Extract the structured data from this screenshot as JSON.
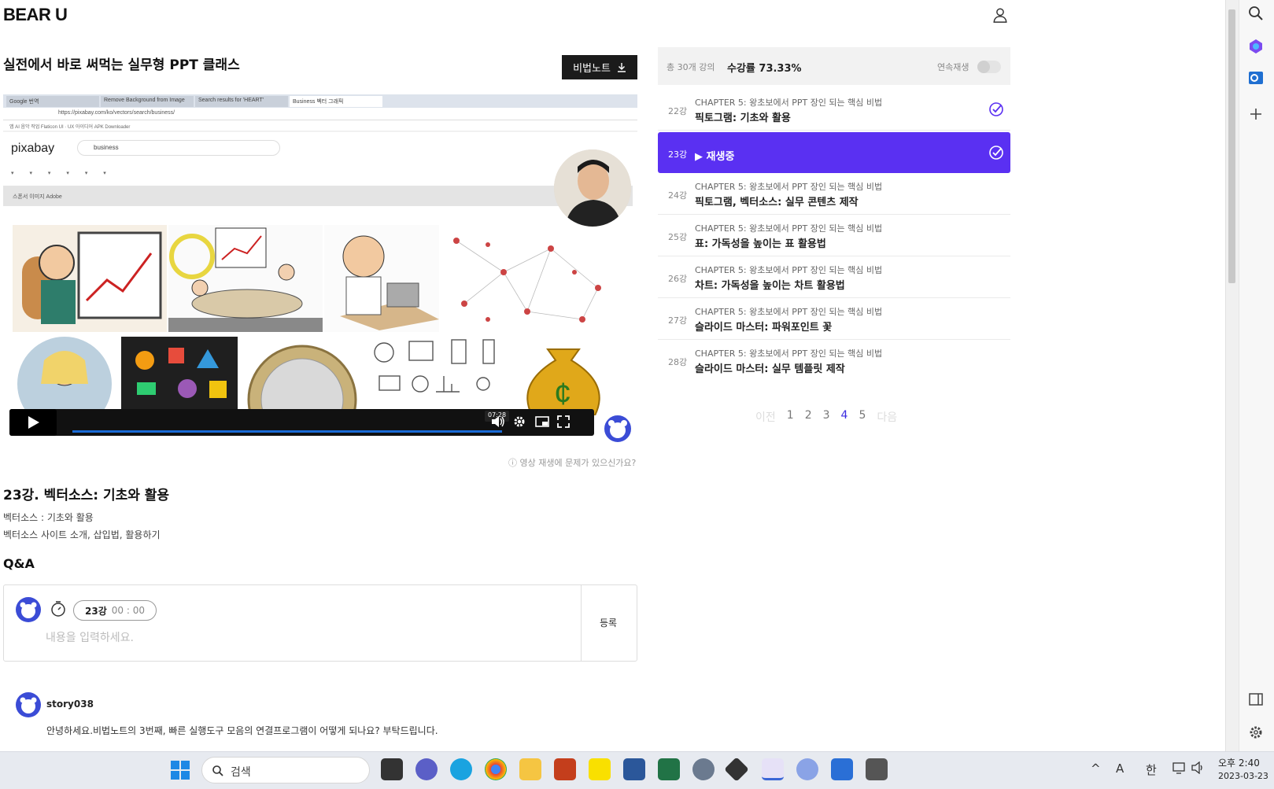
{
  "header": {
    "logo": "BEAR U",
    "user_icon": "user-icon"
  },
  "course": {
    "title": "실전에서 바로 써먹는 실무형 PPT 클래스",
    "notes_button": "비법노트"
  },
  "video": {
    "tabs": [
      "Google 번역",
      "Remove Background from Image",
      "Search results for 'HEART'",
      "Business 벡터 그래픽"
    ],
    "address": "https://pixabay.com/ko/vectors/search/business/",
    "bookmarks": "앱  AI  음악  작업  Flaticon  UI · UX  아이디어  APK Downloader",
    "site_logo": "pixabay",
    "search_value": "business",
    "ad_band": "스폰서 이미지 Adobe",
    "time": "07:28",
    "problem_link": "영상 재생에 문제가 있으신가요?"
  },
  "lesson": {
    "title": "23강. 벡터소스: 기초와 활용",
    "sub1": "벡터소스 : 기초와 활용",
    "sub2": "벡터소스 사이트 소개, 삽입법, 활용하기",
    "qa_heading": "Q&A"
  },
  "qa": {
    "lecture": "23강",
    "timestamp": "00 : 00",
    "placeholder": "내용을 입력하세요.",
    "register": "등록"
  },
  "comment": {
    "user": "story038",
    "text": "안녕하세요.비법노트의 3번째, 빠른 실행도구 모음의 연결프로그램이 어떻게 되나요? 부탁드립니다."
  },
  "playlist": {
    "count": "총 30개 강의",
    "rate": "수강률 73.33%",
    "autoplay": "연속재생",
    "lessons": [
      {
        "num": "22강",
        "chapter": "CHAPTER 5: 왕초보에서 PPT 장인 되는 핵심 비법",
        "title": "픽토그램: 기초와 활용",
        "done": true
      },
      {
        "num": "23강",
        "chapter": "",
        "title": "▶ 재생중",
        "done": true
      },
      {
        "num": "24강",
        "chapter": "CHAPTER 5: 왕초보에서 PPT 장인 되는 핵심 비법",
        "title": "픽토그램, 벡터소스: 실무 콘텐츠 제작",
        "done": false
      },
      {
        "num": "25강",
        "chapter": "CHAPTER 5: 왕초보에서 PPT 장인 되는 핵심 비법",
        "title": "표: 가독성을 높이는 표 활용법",
        "done": false
      },
      {
        "num": "26강",
        "chapter": "CHAPTER 5: 왕초보에서 PPT 장인 되는 핵심 비법",
        "title": "차트: 가독성을 높이는 차트 활용법",
        "done": false
      },
      {
        "num": "27강",
        "chapter": "CHAPTER 5: 왕초보에서 PPT 장인 되는 핵심 비법",
        "title": "슬라이드 마스터: 파워포인트 꽃",
        "done": false
      },
      {
        "num": "28강",
        "chapter": "CHAPTER 5: 왕초보에서 PPT 장인 되는 핵심 비법",
        "title": "슬라이드 마스터: 실무 템플릿 제작",
        "done": false
      }
    ],
    "pager": {
      "prev": "이전",
      "pages": [
        "1",
        "2",
        "3",
        "4",
        "5"
      ],
      "current": "4",
      "next": "다음"
    }
  },
  "taskbar": {
    "search": "검색",
    "time": "오후 2:40",
    "date": "2023-03-23",
    "ime": "한",
    "lang": "A"
  },
  "colors": {
    "accent": "#5a30f2",
    "bear": "#3b4cd6",
    "progress": "#1a6bd6"
  }
}
